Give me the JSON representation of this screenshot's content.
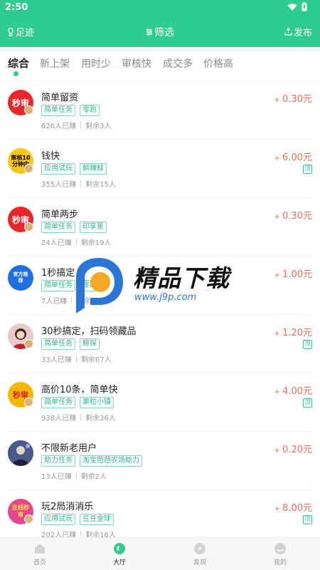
{
  "status": {
    "time": "2:50"
  },
  "header": {
    "left": "足迹",
    "center": "筛选",
    "right": "发布"
  },
  "tabs": [
    {
      "label": "综合",
      "active": true
    },
    {
      "label": "新上架"
    },
    {
      "label": "用时少"
    },
    {
      "label": "审核快"
    },
    {
      "label": "成交多"
    },
    {
      "label": "价格高"
    }
  ],
  "tasks": [
    {
      "title": "简单留资",
      "tags": [
        "简单任务",
        "零跑"
      ],
      "done": "626人已赚",
      "left": "剩余3人",
      "price": "0.30元",
      "top": false,
      "avatar_text": "秒审",
      "avatar_color": "#e8262b"
    },
    {
      "title": "钱快",
      "tags": [
        "应用试玩",
        "躺赚蛙"
      ],
      "done": "355人已赚",
      "left": "剩余15人",
      "price": "6.00元",
      "top": true,
      "top_label": "顶",
      "avatar_text": "审核10分钟内",
      "avatar_color": "#f5c518"
    },
    {
      "title": "简单两步",
      "tags": [
        "简单任务",
        "印享星"
      ],
      "done": "24人已赚",
      "left": "剩余19人",
      "price": "0.30元",
      "top": false,
      "avatar_text": "秒审",
      "avatar_color": "#e8262b"
    },
    {
      "title": "1秒搞定",
      "tags": [
        "简单任务",
        "零跑"
      ],
      "done": "7人已赚",
      "left": "剩余",
      "price": "1.00元",
      "top": false,
      "avatar_text": "官方推荐",
      "avatar_color": "#1f6fe0"
    },
    {
      "title": "30秒搞定，扫码领藏品",
      "tags": [
        "简单任务",
        "鲸探"
      ],
      "done": "33人已赚",
      "left": "剩余67人",
      "price": "1.20元",
      "top": true,
      "top_label": "顶",
      "avatar_text": "",
      "avatar_color": "#d9a0a0"
    },
    {
      "title": "高价10条，简单快",
      "tags": [
        "简单任务",
        "果粒小镇"
      ],
      "done": "938人已赚",
      "left": "剩余36人",
      "price": "4.00元",
      "top": true,
      "top_label": "顶",
      "avatar_text": "秒审",
      "avatar_color": "#f2b705"
    },
    {
      "title": "不限新老用户",
      "tags": [
        "助力任务",
        "淘宝芭芭农场助力"
      ],
      "done": "13人已赚",
      "left": "剩余2人",
      "price": "0.20元",
      "top": false,
      "avatar_text": "",
      "avatar_color": "#3a4a78"
    },
    {
      "title": "玩2局消消乐",
      "tags": [
        "应用试玩",
        "豆豆金球"
      ],
      "done": "202人已赚",
      "left": "剩余16人",
      "price": "8.00元",
      "top": true,
      "top_label": "顶",
      "avatar_text": "在线秒审",
      "avatar_color": "#e8468c"
    }
  ],
  "watermark": {
    "title": "精品下载",
    "url": "www.j9p.com"
  },
  "bottom_nav": [
    {
      "label": "首页"
    },
    {
      "label": "大厅",
      "active": true
    },
    {
      "label": "发现"
    },
    {
      "label": "我的"
    }
  ],
  "colors": {
    "brand": "#2ecc91",
    "price": "#f36a5a"
  }
}
